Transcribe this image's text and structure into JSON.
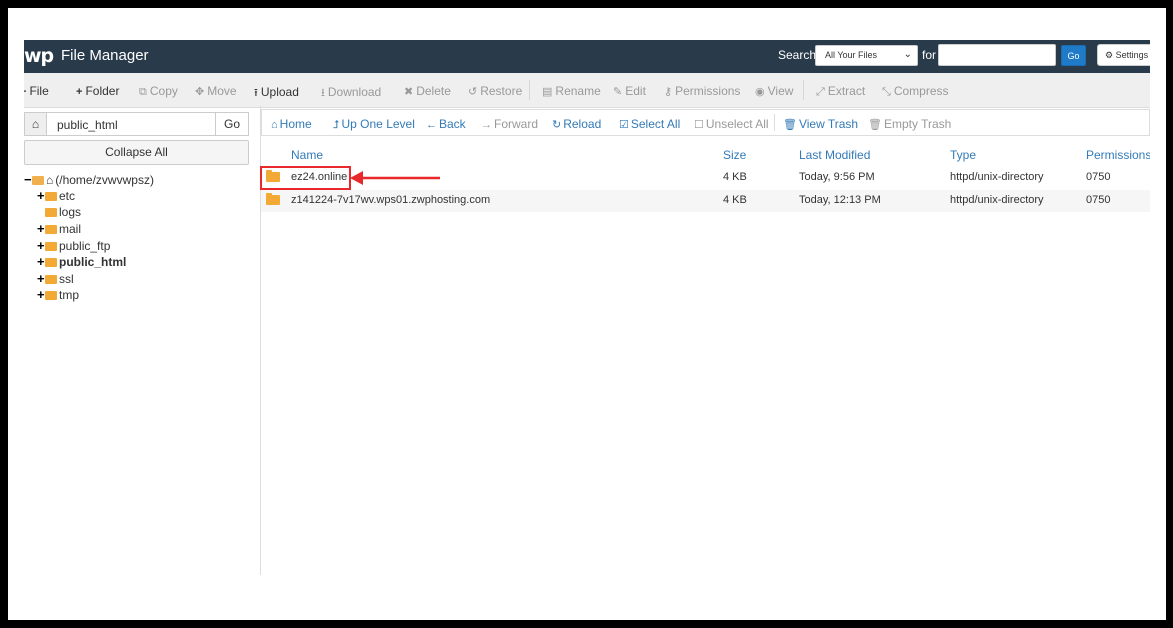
{
  "header": {
    "brand": "wp",
    "title": "File Manager",
    "search_label": "Search",
    "search_scope": "All Your Files",
    "for_label": "for",
    "search_value": "",
    "go_label": "Go",
    "settings_label": "Settings"
  },
  "toolbar": [
    {
      "label": "File",
      "icon": "plus-icon",
      "glyph": "+",
      "enabled": true
    },
    {
      "label": "Folder",
      "icon": "plus-icon",
      "glyph": "+",
      "enabled": true
    },
    {
      "label": "Copy",
      "icon": "copy-icon",
      "glyph": "⧉",
      "enabled": false
    },
    {
      "label": "Move",
      "icon": "move-icon",
      "glyph": "✥",
      "enabled": false
    },
    {
      "label": "Upload",
      "icon": "upload-icon",
      "glyph": "⭱",
      "enabled": true
    },
    {
      "label": "Download",
      "icon": "download-icon",
      "glyph": "⭳",
      "enabled": false
    },
    {
      "label": "Delete",
      "icon": "delete-icon",
      "glyph": "✖",
      "enabled": false
    },
    {
      "label": "Restore",
      "icon": "restore-icon",
      "glyph": "↺",
      "enabled": false
    },
    {
      "label": "Rename",
      "icon": "rename-icon",
      "glyph": "▤",
      "enabled": false
    },
    {
      "label": "Edit",
      "icon": "edit-icon",
      "glyph": "✎",
      "enabled": false
    },
    {
      "label": "Permissions",
      "icon": "key-icon",
      "glyph": "⚷",
      "enabled": false
    },
    {
      "label": "View",
      "icon": "eye-icon",
      "glyph": "◉",
      "enabled": false
    },
    {
      "label": "Extract",
      "icon": "extract-icon",
      "glyph": "⤢",
      "enabled": false
    },
    {
      "label": "Compress",
      "icon": "compress-icon",
      "glyph": "⤡",
      "enabled": false
    }
  ],
  "sidebar": {
    "path_value": "public_html",
    "go_label": "Go",
    "collapse_label": "Collapse All",
    "tree": [
      {
        "label": "(/home/zvwvwpsz)",
        "toggle": "−",
        "home": true,
        "bold": false
      },
      {
        "label": "etc",
        "toggle": "+",
        "bold": false
      },
      {
        "label": "logs",
        "toggle": "",
        "bold": false
      },
      {
        "label": "mail",
        "toggle": "+",
        "bold": false
      },
      {
        "label": "public_ftp",
        "toggle": "+",
        "bold": false
      },
      {
        "label": "public_html",
        "toggle": "+",
        "bold": true
      },
      {
        "label": "ssl",
        "toggle": "+",
        "bold": false
      },
      {
        "label": "tmp",
        "toggle": "+",
        "bold": false
      }
    ]
  },
  "nav": [
    {
      "label": "Home",
      "icon": "home-icon",
      "glyph": "⌂",
      "enabled": true
    },
    {
      "label": "Up One Level",
      "icon": "up-level-icon",
      "glyph": "⮥",
      "enabled": true
    },
    {
      "label": "Back",
      "icon": "back-arrow-icon",
      "glyph": "←",
      "enabled": true
    },
    {
      "label": "Forward",
      "icon": "forward-arrow-icon",
      "glyph": "→",
      "enabled": false
    },
    {
      "label": "Reload",
      "icon": "reload-icon",
      "glyph": "↻",
      "enabled": true
    },
    {
      "label": "Select All",
      "icon": "checked-box-icon",
      "glyph": "☑",
      "enabled": true
    },
    {
      "label": "Unselect All",
      "icon": "empty-box-icon",
      "glyph": "☐",
      "enabled": false
    },
    {
      "label": "View Trash",
      "icon": "trash-icon",
      "glyph": "🗑",
      "enabled": true
    },
    {
      "label": "Empty Trash",
      "icon": "trash-icon",
      "glyph": "🗑",
      "enabled": false
    }
  ],
  "table": {
    "columns": [
      "Name",
      "Size",
      "Last Modified",
      "Type",
      "Permissions"
    ],
    "rows": [
      {
        "name": "ez24.online",
        "size": "4 KB",
        "modified": "Today, 9:56 PM",
        "type": "httpd/unix-directory",
        "perms": "0750"
      },
      {
        "name": "z141224-7v17wv.wps01.zwphosting.com",
        "size": "4 KB",
        "modified": "Today, 12:13 PM",
        "type": "httpd/unix-directory",
        "perms": "0750"
      }
    ]
  },
  "colors": {
    "header_bg": "#293a4a",
    "link": "#337ab7",
    "folder": "#f3a935",
    "highlight": "#e8282b"
  }
}
